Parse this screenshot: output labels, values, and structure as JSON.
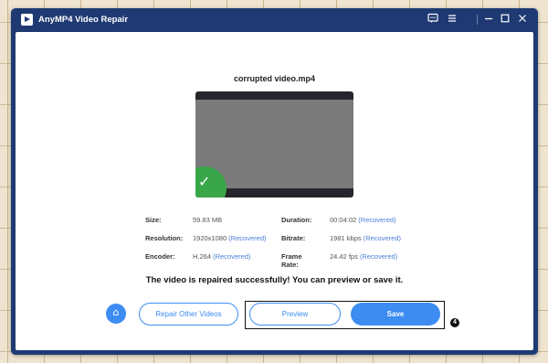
{
  "window": {
    "title": "AnyMP4 Video Repair"
  },
  "titlebar": {
    "icons": [
      "feedback-icon",
      "menu-icon",
      "minimize-icon",
      "maximize-icon",
      "close-icon"
    ]
  },
  "video": {
    "file_name": "corrupted video.mp4"
  },
  "details": {
    "size_label": "Size:",
    "size_value": "59.83 MB",
    "resolution_label": "Resolution:",
    "resolution_value": "1920x1080",
    "encoder_label": "Encoder:",
    "encoder_value": "H.264",
    "duration_label": "Duration:",
    "duration_value": "00:04:02",
    "bitrate_label": "Bitrate:",
    "bitrate_value": "1981 kbps",
    "framerate_label": "Frame Rate:",
    "framerate_value": "24.42 fps",
    "recovered_tag": "(Recovered)"
  },
  "message": "The video is repaired successfully! You can preview or save it.",
  "actions": {
    "repair_other_label": "Repair Other Videos",
    "preview_label": "Preview",
    "save_label": "Save"
  },
  "annotation": {
    "step_number": "4"
  },
  "colors": {
    "titlebar": "#1f3a73",
    "accent": "#3d8cf2",
    "success_badge": "#3aa64a",
    "recovered_text": "#4a7fd6"
  }
}
